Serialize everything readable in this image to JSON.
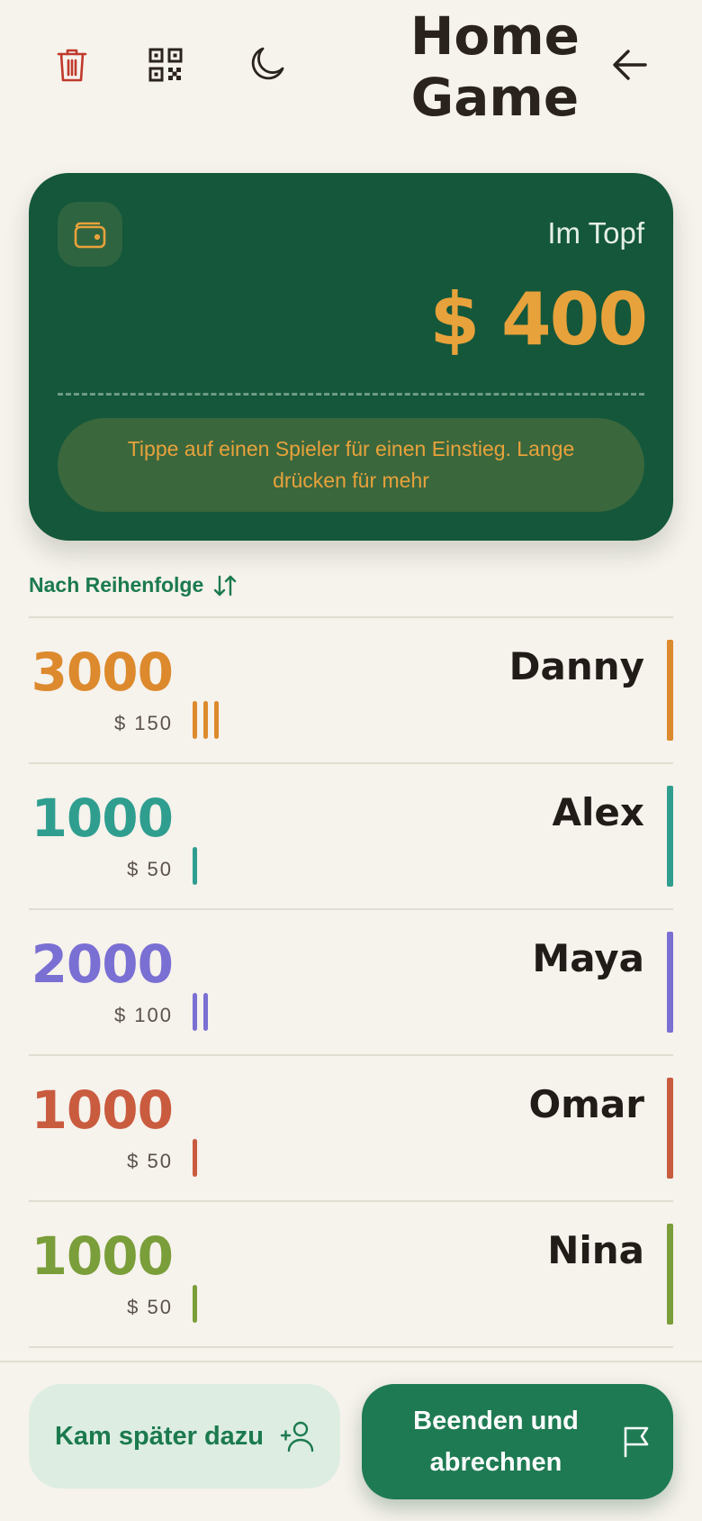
{
  "header": {
    "title_line1": "Home",
    "title_line2": "Game",
    "icons": [
      "trash-icon",
      "qr-code-icon",
      "moon-icon",
      "arrow-left-icon"
    ]
  },
  "pot": {
    "label": "Im Topf",
    "amount": "$ 400",
    "hint": "Tippe auf einen Spieler für einen Einstieg. Lange drücken für mehr",
    "icon": "wallet-icon"
  },
  "sort": {
    "label": "Nach Reihenfolge",
    "icon": "sort-arrows-icon"
  },
  "players": [
    {
      "name": "Danny",
      "chips": "3000",
      "money": "$ 150",
      "buyins": 3,
      "color": "#DC8A2D"
    },
    {
      "name": "Alex",
      "chips": "1000",
      "money": "$ 50",
      "buyins": 1,
      "color": "#2F9E8F"
    },
    {
      "name": "Maya",
      "chips": "2000",
      "money": "$ 100",
      "buyins": 2,
      "color": "#7A6FD3"
    },
    {
      "name": "Omar",
      "chips": "1000",
      "money": "$ 50",
      "buyins": 1,
      "color": "#C95B3F"
    },
    {
      "name": "Nina",
      "chips": "1000",
      "money": "$ 50",
      "buyins": 1,
      "color": "#7A9E3A"
    }
  ],
  "actions": {
    "late_join": "Kam später dazu",
    "end_line1": "Beenden und",
    "end_line2": "abrechnen"
  },
  "colors": {
    "accent": "#1B7A4E",
    "pot_bg": "#14573B",
    "gold": "#E8A23B",
    "danger": "#C0392B"
  }
}
